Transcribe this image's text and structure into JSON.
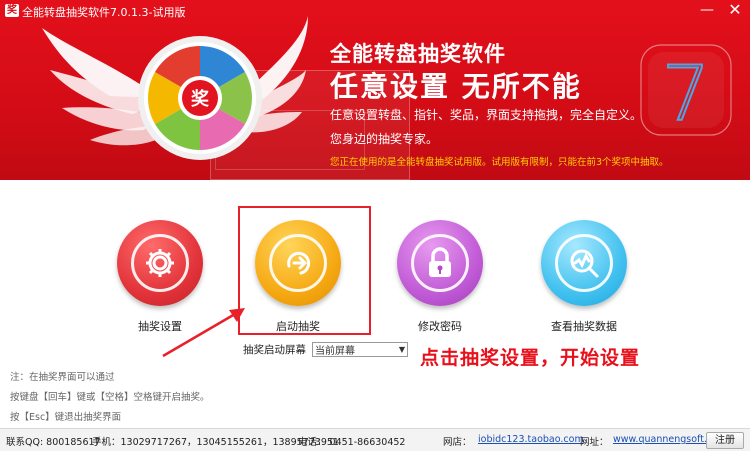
{
  "window": {
    "title": "全能转盘抽奖软件7.0.1.3-试用版",
    "min_label": "—",
    "close_label": "✕"
  },
  "banner": {
    "brand_title": "全能转盘抽奖软件",
    "slogan": "任意设置  无所不能",
    "desc_line1": "任意设置转盘、指针、奖品，界面支持拖拽，完全自定义。",
    "desc_line2": "您身边的抽奖专家。",
    "trial_notice": "您正在使用的是全能转盘抽奖试用版。试用版有限制，只能在前3个奖项中抽取。",
    "wheel_badge": "奖",
    "version_glyph": "7"
  },
  "actions": [
    {
      "label": "抽奖设置",
      "icon": "gear-icon"
    },
    {
      "label": "启动抽奖",
      "icon": "start-arrow-icon"
    },
    {
      "label": "修改密码",
      "icon": "lock-icon"
    },
    {
      "label": "查看抽奖数据",
      "icon": "data-search-icon"
    }
  ],
  "screen": {
    "label": "抽奖启动屏幕",
    "selected": "当前屏幕"
  },
  "callout": "点击抽奖设置，开始设置",
  "notes": [
    "注：在抽奖界面可以通过",
    "按键盘【回车】键或【空格】空格键开启抽奖。",
    "按【Esc】键退出抽奖界面"
  ],
  "footer": {
    "qq": "联系QQ: 800185617",
    "phone": "手机：13029717267，13045155261，13895773951",
    "tel": "电话： 0451-86630452",
    "web1_label": "网店：",
    "web1": "iobidc123.taobao.com",
    "web2_label": "网址：",
    "web2": "www.quannengsoft.cn",
    "register": "注册"
  },
  "colors": {
    "banner_red": "#d30c16",
    "callout_red": "#e8101b",
    "trial_yellow": "#ffd200"
  }
}
